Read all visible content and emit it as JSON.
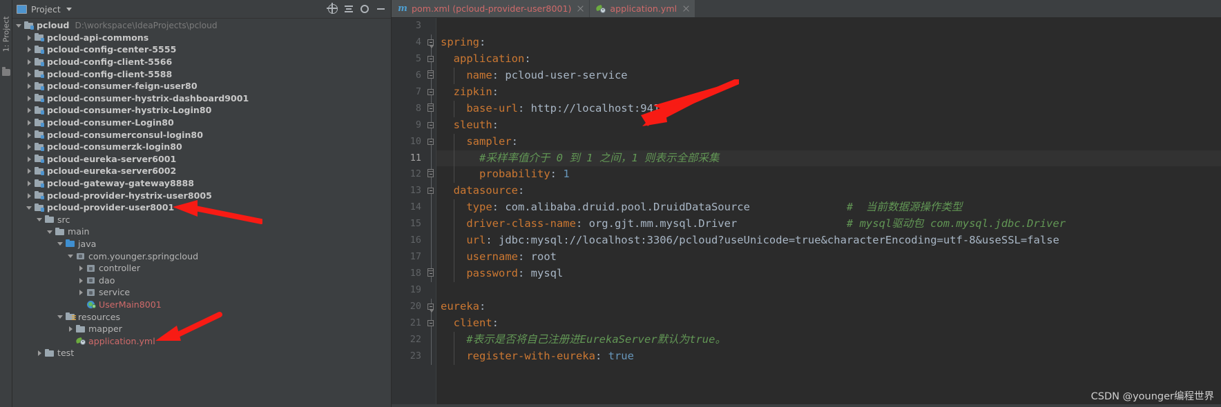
{
  "window": {
    "left_strip_label": "1: Project"
  },
  "project_panel": {
    "title": "Project",
    "icons": {
      "project": "project-icon",
      "caret": "chevron-down-icon",
      "locate": "locate-target-icon",
      "collapse": "collapse-all-icon",
      "settings": "gear-icon",
      "hide": "minimize-icon"
    },
    "tree": [
      {
        "depth": 0,
        "label": "pcloud",
        "path": "D:\\workspace\\IdeaProjects\\pcloud",
        "icon": "module",
        "arrow": "down",
        "bold": true,
        "color": "normal"
      },
      {
        "depth": 1,
        "label": "pcloud-api-commons",
        "path": "",
        "icon": "module",
        "arrow": "right",
        "bold": true,
        "color": "normal"
      },
      {
        "depth": 1,
        "label": "pcloud-config-center-5555",
        "path": "",
        "icon": "module",
        "arrow": "right",
        "bold": true,
        "color": "normal"
      },
      {
        "depth": 1,
        "label": "pcloud-config-client-5566",
        "path": "",
        "icon": "module",
        "arrow": "right",
        "bold": true,
        "color": "normal"
      },
      {
        "depth": 1,
        "label": "pcloud-config-client-5588",
        "path": "",
        "icon": "module",
        "arrow": "right",
        "bold": true,
        "color": "normal"
      },
      {
        "depth": 1,
        "label": "pcloud-consumer-feign-user80",
        "path": "",
        "icon": "module",
        "arrow": "right",
        "bold": true,
        "color": "normal"
      },
      {
        "depth": 1,
        "label": "pcloud-consumer-hystrix-dashboard9001",
        "path": "",
        "icon": "module",
        "arrow": "right",
        "bold": true,
        "color": "normal"
      },
      {
        "depth": 1,
        "label": "pcloud-consumer-hystrix-Login80",
        "path": "",
        "icon": "module",
        "arrow": "right",
        "bold": true,
        "color": "normal"
      },
      {
        "depth": 1,
        "label": "pcloud-consumer-Login80",
        "path": "",
        "icon": "module",
        "arrow": "right",
        "bold": true,
        "color": "normal"
      },
      {
        "depth": 1,
        "label": "pcloud-consumerconsul-login80",
        "path": "",
        "icon": "module",
        "arrow": "right",
        "bold": true,
        "color": "normal"
      },
      {
        "depth": 1,
        "label": "pcloud-consumerzk-login80",
        "path": "",
        "icon": "module",
        "arrow": "right",
        "bold": true,
        "color": "normal"
      },
      {
        "depth": 1,
        "label": "pcloud-eureka-server6001",
        "path": "",
        "icon": "module",
        "arrow": "right",
        "bold": true,
        "color": "normal"
      },
      {
        "depth": 1,
        "label": "pcloud-eureka-server6002",
        "path": "",
        "icon": "module",
        "arrow": "right",
        "bold": true,
        "color": "normal"
      },
      {
        "depth": 1,
        "label": "pcloud-gateway-gateway8888",
        "path": "",
        "icon": "module",
        "arrow": "right",
        "bold": true,
        "color": "normal"
      },
      {
        "depth": 1,
        "label": "pcloud-provider-hystrix-user8005",
        "path": "",
        "icon": "module",
        "arrow": "right",
        "bold": true,
        "color": "normal"
      },
      {
        "depth": 1,
        "label": "pcloud-provider-user8001",
        "path": "",
        "icon": "module",
        "arrow": "down",
        "bold": true,
        "color": "normal"
      },
      {
        "depth": 2,
        "label": "src",
        "path": "",
        "icon": "folder",
        "arrow": "down",
        "bold": false,
        "color": "normal"
      },
      {
        "depth": 3,
        "label": "main",
        "path": "",
        "icon": "folder",
        "arrow": "down",
        "bold": false,
        "color": "normal"
      },
      {
        "depth": 4,
        "label": "java",
        "path": "",
        "icon": "srcfolder",
        "arrow": "down",
        "bold": false,
        "color": "normal"
      },
      {
        "depth": 5,
        "label": "com.younger.springcloud",
        "path": "",
        "icon": "pkg",
        "arrow": "down",
        "bold": false,
        "color": "normal"
      },
      {
        "depth": 6,
        "label": "controller",
        "path": "",
        "icon": "pkg",
        "arrow": "right",
        "bold": false,
        "color": "normal"
      },
      {
        "depth": 6,
        "label": "dao",
        "path": "",
        "icon": "pkg",
        "arrow": "right",
        "bold": false,
        "color": "normal"
      },
      {
        "depth": 6,
        "label": "service",
        "path": "",
        "icon": "pkg",
        "arrow": "right",
        "bold": false,
        "color": "normal"
      },
      {
        "depth": 6,
        "label": "UserMain8001",
        "path": "",
        "icon": "javacls",
        "arrow": "none",
        "bold": false,
        "color": "red"
      },
      {
        "depth": 4,
        "label": "resources",
        "path": "",
        "icon": "resfolder",
        "arrow": "down",
        "bold": false,
        "color": "normal"
      },
      {
        "depth": 5,
        "label": "mapper",
        "path": "",
        "icon": "folder",
        "arrow": "right",
        "bold": false,
        "color": "normal"
      },
      {
        "depth": 5,
        "label": "application.yml",
        "path": "",
        "icon": "yml",
        "arrow": "none",
        "bold": false,
        "color": "red"
      },
      {
        "depth": 2,
        "label": "test",
        "path": "",
        "icon": "folder",
        "arrow": "right",
        "bold": false,
        "color": "normal"
      }
    ]
  },
  "editor": {
    "tabs": [
      {
        "label": "pom.xml (pcloud-provider-user8001)",
        "icon": "maven-icon",
        "active": false,
        "closable": true
      },
      {
        "label": "application.yml",
        "icon": "spring-yaml-icon",
        "active": true,
        "closable": true
      }
    ],
    "first_line_number": 3,
    "current_line": 11,
    "lines": [
      {
        "num": 3,
        "fold": "none",
        "indentGuides": [],
        "tokens": []
      },
      {
        "num": 4,
        "fold": "start-top",
        "indentGuides": [],
        "tokens": [
          {
            "t": "spring",
            "c": "k"
          },
          {
            "t": ":",
            "c": "p"
          }
        ]
      },
      {
        "num": 5,
        "fold": "start",
        "indentGuides": [],
        "tokens": [
          {
            "t": "  ",
            "c": "v"
          },
          {
            "t": "application",
            "c": "k"
          },
          {
            "t": ":",
            "c": "p"
          }
        ]
      },
      {
        "num": 6,
        "fold": "end",
        "indentGuides": [
          1
        ],
        "tokens": [
          {
            "t": "    ",
            "c": "v"
          },
          {
            "t": "name",
            "c": "k"
          },
          {
            "t": ": ",
            "c": "p"
          },
          {
            "t": "pcloud-user-service",
            "c": "v"
          }
        ]
      },
      {
        "num": 7,
        "fold": "start",
        "indentGuides": [],
        "tokens": [
          {
            "t": "  ",
            "c": "v"
          },
          {
            "t": "zipkin",
            "c": "k"
          },
          {
            "t": ":",
            "c": "p"
          }
        ]
      },
      {
        "num": 8,
        "fold": "end",
        "indentGuides": [
          1
        ],
        "tokens": [
          {
            "t": "    ",
            "c": "v"
          },
          {
            "t": "base-url",
            "c": "k"
          },
          {
            "t": ": ",
            "c": "p"
          },
          {
            "t": "http://localhost:9411",
            "c": "v"
          }
        ]
      },
      {
        "num": 9,
        "fold": "start",
        "indentGuides": [],
        "tokens": [
          {
            "t": "  ",
            "c": "v"
          },
          {
            "t": "sleuth",
            "c": "k"
          },
          {
            "t": ":",
            "c": "p"
          }
        ]
      },
      {
        "num": 10,
        "fold": "start",
        "indentGuides": [
          1
        ],
        "tokens": [
          {
            "t": "    ",
            "c": "v"
          },
          {
            "t": "sampler",
            "c": "k"
          },
          {
            "t": ":",
            "c": "p"
          }
        ]
      },
      {
        "num": 11,
        "fold": "none",
        "indentGuides": [
          1
        ],
        "tokens": [
          {
            "t": "      ",
            "c": "v"
          },
          {
            "t": "#采样率值介于 0 到 1 之间，1 则表示全部采集",
            "c": "c"
          }
        ]
      },
      {
        "num": 12,
        "fold": "end",
        "indentGuides": [
          1
        ],
        "tokens": [
          {
            "t": "      ",
            "c": "v"
          },
          {
            "t": "probability",
            "c": "k"
          },
          {
            "t": ": ",
            "c": "p"
          },
          {
            "t": "1",
            "c": "n"
          }
        ]
      },
      {
        "num": 13,
        "fold": "start",
        "indentGuides": [],
        "tokens": [
          {
            "t": "  ",
            "c": "v"
          },
          {
            "t": "datasource",
            "c": "k"
          },
          {
            "t": ":",
            "c": "p"
          }
        ]
      },
      {
        "num": 14,
        "fold": "none",
        "indentGuides": [
          1
        ],
        "tokens": [
          {
            "t": "    ",
            "c": "v"
          },
          {
            "t": "type",
            "c": "k"
          },
          {
            "t": ": ",
            "c": "p"
          },
          {
            "t": "com.alibaba.druid.pool.DruidDataSource",
            "c": "v"
          }
        ],
        "comment": "#  当前数据源操作类型",
        "comment_col": 63
      },
      {
        "num": 15,
        "fold": "none",
        "indentGuides": [
          1
        ],
        "tokens": [
          {
            "t": "    ",
            "c": "v"
          },
          {
            "t": "driver-class-name",
            "c": "k"
          },
          {
            "t": ": ",
            "c": "p"
          },
          {
            "t": "org.gjt.mm.mysql.Driver",
            "c": "v"
          }
        ],
        "comment": "# mysql驱动包 com.mysql.jdbc.Driver",
        "comment_col": 63
      },
      {
        "num": 16,
        "fold": "none",
        "indentGuides": [
          1
        ],
        "tokens": [
          {
            "t": "    ",
            "c": "v"
          },
          {
            "t": "url",
            "c": "k"
          },
          {
            "t": ": ",
            "c": "p"
          },
          {
            "t": "jdbc:mysql://localhost:3306/pcloud?useUnicode=true&characterEncoding=utf-8&useSSL=false",
            "c": "v"
          }
        ]
      },
      {
        "num": 17,
        "fold": "none",
        "indentGuides": [
          1
        ],
        "tokens": [
          {
            "t": "    ",
            "c": "v"
          },
          {
            "t": "username",
            "c": "k"
          },
          {
            "t": ": ",
            "c": "p"
          },
          {
            "t": "root",
            "c": "v"
          }
        ]
      },
      {
        "num": 18,
        "fold": "end",
        "indentGuides": [
          1
        ],
        "tokens": [
          {
            "t": "    ",
            "c": "v"
          },
          {
            "t": "password",
            "c": "k"
          },
          {
            "t": ": ",
            "c": "p"
          },
          {
            "t": "mysql",
            "c": "v"
          }
        ]
      },
      {
        "num": 19,
        "fold": "none",
        "indentGuides": [],
        "tokens": []
      },
      {
        "num": 20,
        "fold": "start-top",
        "indentGuides": [],
        "tokens": [
          {
            "t": "eureka",
            "c": "k"
          },
          {
            "t": ":",
            "c": "p"
          }
        ]
      },
      {
        "num": 21,
        "fold": "start",
        "indentGuides": [],
        "tokens": [
          {
            "t": "  ",
            "c": "v"
          },
          {
            "t": "client",
            "c": "k"
          },
          {
            "t": ":",
            "c": "p"
          }
        ]
      },
      {
        "num": 22,
        "fold": "none",
        "indentGuides": [
          1
        ],
        "tokens": [
          {
            "t": "    ",
            "c": "v"
          },
          {
            "t": "#表示是否将自己注册进EurekaServer默认为true。",
            "c": "c"
          }
        ]
      },
      {
        "num": 23,
        "fold": "none",
        "indentGuides": [
          1
        ],
        "tokens": [
          {
            "t": "    ",
            "c": "v"
          },
          {
            "t": "register-with-eureka",
            "c": "k"
          },
          {
            "t": ": ",
            "c": "p"
          },
          {
            "t": "true",
            "c": "n"
          }
        ]
      }
    ]
  },
  "annotations": {
    "arrow_color": "#f81b14",
    "arrows": [
      {
        "name": "arrow-to-sampler-line"
      },
      {
        "name": "arrow-to-module-pcloud-provider-user8001"
      },
      {
        "name": "arrow-to-application-yml"
      }
    ]
  },
  "watermark": {
    "text": "CSDN @younger编程世界"
  },
  "colors": {
    "background": "#2b2b2b",
    "panel": "#3c3f41",
    "gutter": "#313335",
    "keyword": "#cc7832",
    "comment": "#629755",
    "number": "#6897bb",
    "text": "#a9b7c6",
    "tab_text": "#cf6a6a",
    "accent_blue": "#4e94ce"
  }
}
